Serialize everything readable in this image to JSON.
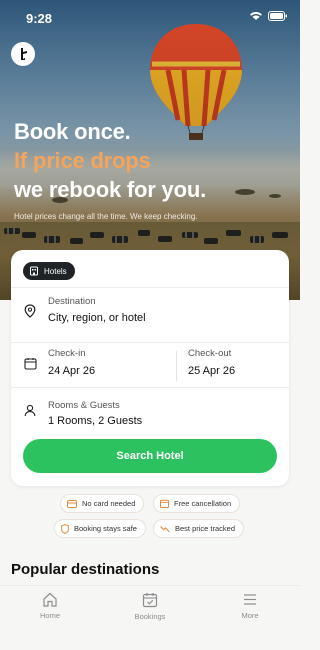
{
  "status_bar": {
    "time": "9:28"
  },
  "hero": {
    "line1": "Book once.",
    "line2": "If price drops",
    "line3": "we rebook for you.",
    "subline": "Hotel prices change all the time. We keep checking."
  },
  "search_card": {
    "chip_label": "Hotels",
    "destination": {
      "label": "Destination",
      "placeholder": "City, region, or hotel"
    },
    "check_in": {
      "label": "Check-in",
      "value": "24 Apr 26"
    },
    "check_out": {
      "label": "Check-out",
      "value": "25 Apr 26"
    },
    "guests": {
      "label": "Rooms & Guests",
      "value": "1 Rooms, 2 Guests"
    },
    "search_label": "Search Hotel"
  },
  "badges": [
    "No card needed",
    "Free cancellation",
    "Booking stays safe",
    "Best price tracked"
  ],
  "colors": {
    "accent_orange": "#f5a45c",
    "primary_green": "#2bc25f",
    "chip_dark": "#1f2328"
  },
  "section_title": "Popular destinations",
  "tabs": [
    {
      "label": "Home",
      "icon": "home-icon"
    },
    {
      "label": "Bookings",
      "icon": "calendar-check-icon"
    },
    {
      "label": "More",
      "icon": "menu-icon"
    }
  ]
}
